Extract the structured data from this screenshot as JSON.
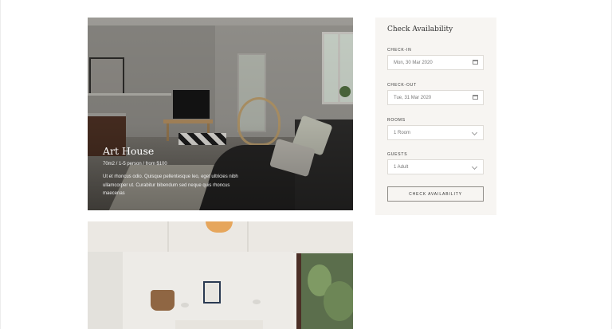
{
  "room": {
    "name": "Art House",
    "meta": "70m2 / 1-5 person / from  $100",
    "description": "Ut et rhoncus odio. Quisque pellentesque leo, eget ultricies nibh ullamcorper ut. Curabitur bibendum sed neque quis rhoncus maecenas"
  },
  "availability": {
    "title": "Check Availability",
    "checkin_label": "CHECK-IN",
    "checkin_value": "Mon, 30 Mar 2020",
    "checkout_label": "CHECK-OUT",
    "checkout_value": "Tue, 31 Mar 2020",
    "rooms_label": "ROOMS",
    "rooms_value": "1 Room",
    "guests_label": "GUESTS",
    "guests_value": "1 Adult",
    "button_label": "CHECK AVAILABILITY"
  },
  "icons": {
    "checkin": "calendar-icon",
    "checkout": "calendar-icon",
    "rooms": "chevron-down-icon",
    "guests": "chevron-down-icon"
  },
  "colors": {
    "panel_bg": "#f7f5f2",
    "text": "#333333"
  }
}
